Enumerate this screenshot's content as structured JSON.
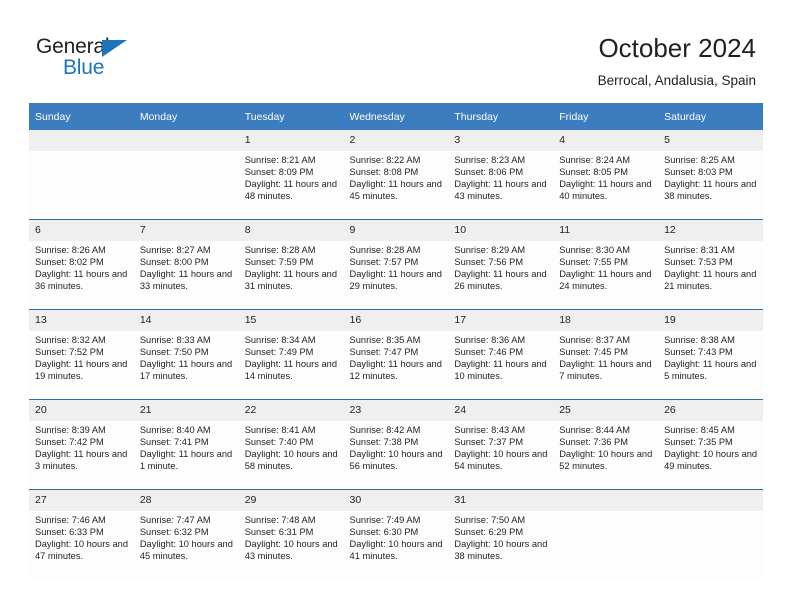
{
  "brand": {
    "name_top": "General",
    "name_bottom": "Blue",
    "triangle_color": "#1b75bb"
  },
  "header": {
    "title": "October 2024",
    "subtitle": "Berrocal, Andalusia, Spain"
  },
  "theme": {
    "header_row_bg": "#3b7dbf",
    "header_row_text": "#ffffff",
    "row_divider": "#2e6da8",
    "date_band_bg": "#efefef",
    "cell_bg": "#fdfdfd",
    "text": "#231f20"
  },
  "weekday_headers": [
    "Sunday",
    "Monday",
    "Tuesday",
    "Wednesday",
    "Thursday",
    "Friday",
    "Saturday"
  ],
  "labels": {
    "sunrise_prefix": "Sunrise:",
    "sunset_prefix": "Sunset:",
    "daylight_prefix": "Daylight:"
  },
  "weeks": [
    [
      {
        "day": "",
        "sunrise": "",
        "sunset": "",
        "daylight": ""
      },
      {
        "day": "",
        "sunrise": "",
        "sunset": "",
        "daylight": ""
      },
      {
        "day": "1",
        "sunrise": "Sunrise: 8:21 AM",
        "sunset": "Sunset: 8:09 PM",
        "daylight": "Daylight: 11 hours and 48 minutes."
      },
      {
        "day": "2",
        "sunrise": "Sunrise: 8:22 AM",
        "sunset": "Sunset: 8:08 PM",
        "daylight": "Daylight: 11 hours and 45 minutes."
      },
      {
        "day": "3",
        "sunrise": "Sunrise: 8:23 AM",
        "sunset": "Sunset: 8:06 PM",
        "daylight": "Daylight: 11 hours and 43 minutes."
      },
      {
        "day": "4",
        "sunrise": "Sunrise: 8:24 AM",
        "sunset": "Sunset: 8:05 PM",
        "daylight": "Daylight: 11 hours and 40 minutes."
      },
      {
        "day": "5",
        "sunrise": "Sunrise: 8:25 AM",
        "sunset": "Sunset: 8:03 PM",
        "daylight": "Daylight: 11 hours and 38 minutes."
      }
    ],
    [
      {
        "day": "6",
        "sunrise": "Sunrise: 8:26 AM",
        "sunset": "Sunset: 8:02 PM",
        "daylight": "Daylight: 11 hours and 36 minutes."
      },
      {
        "day": "7",
        "sunrise": "Sunrise: 8:27 AM",
        "sunset": "Sunset: 8:00 PM",
        "daylight": "Daylight: 11 hours and 33 minutes."
      },
      {
        "day": "8",
        "sunrise": "Sunrise: 8:28 AM",
        "sunset": "Sunset: 7:59 PM",
        "daylight": "Daylight: 11 hours and 31 minutes."
      },
      {
        "day": "9",
        "sunrise": "Sunrise: 8:28 AM",
        "sunset": "Sunset: 7:57 PM",
        "daylight": "Daylight: 11 hours and 29 minutes."
      },
      {
        "day": "10",
        "sunrise": "Sunrise: 8:29 AM",
        "sunset": "Sunset: 7:56 PM",
        "daylight": "Daylight: 11 hours and 26 minutes."
      },
      {
        "day": "11",
        "sunrise": "Sunrise: 8:30 AM",
        "sunset": "Sunset: 7:55 PM",
        "daylight": "Daylight: 11 hours and 24 minutes."
      },
      {
        "day": "12",
        "sunrise": "Sunrise: 8:31 AM",
        "sunset": "Sunset: 7:53 PM",
        "daylight": "Daylight: 11 hours and 21 minutes."
      }
    ],
    [
      {
        "day": "13",
        "sunrise": "Sunrise: 8:32 AM",
        "sunset": "Sunset: 7:52 PM",
        "daylight": "Daylight: 11 hours and 19 minutes."
      },
      {
        "day": "14",
        "sunrise": "Sunrise: 8:33 AM",
        "sunset": "Sunset: 7:50 PM",
        "daylight": "Daylight: 11 hours and 17 minutes."
      },
      {
        "day": "15",
        "sunrise": "Sunrise: 8:34 AM",
        "sunset": "Sunset: 7:49 PM",
        "daylight": "Daylight: 11 hours and 14 minutes."
      },
      {
        "day": "16",
        "sunrise": "Sunrise: 8:35 AM",
        "sunset": "Sunset: 7:47 PM",
        "daylight": "Daylight: 11 hours and 12 minutes."
      },
      {
        "day": "17",
        "sunrise": "Sunrise: 8:36 AM",
        "sunset": "Sunset: 7:46 PM",
        "daylight": "Daylight: 11 hours and 10 minutes."
      },
      {
        "day": "18",
        "sunrise": "Sunrise: 8:37 AM",
        "sunset": "Sunset: 7:45 PM",
        "daylight": "Daylight: 11 hours and 7 minutes."
      },
      {
        "day": "19",
        "sunrise": "Sunrise: 8:38 AM",
        "sunset": "Sunset: 7:43 PM",
        "daylight": "Daylight: 11 hours and 5 minutes."
      }
    ],
    [
      {
        "day": "20",
        "sunrise": "Sunrise: 8:39 AM",
        "sunset": "Sunset: 7:42 PM",
        "daylight": "Daylight: 11 hours and 3 minutes."
      },
      {
        "day": "21",
        "sunrise": "Sunrise: 8:40 AM",
        "sunset": "Sunset: 7:41 PM",
        "daylight": "Daylight: 11 hours and 1 minute."
      },
      {
        "day": "22",
        "sunrise": "Sunrise: 8:41 AM",
        "sunset": "Sunset: 7:40 PM",
        "daylight": "Daylight: 10 hours and 58 minutes."
      },
      {
        "day": "23",
        "sunrise": "Sunrise: 8:42 AM",
        "sunset": "Sunset: 7:38 PM",
        "daylight": "Daylight: 10 hours and 56 minutes."
      },
      {
        "day": "24",
        "sunrise": "Sunrise: 8:43 AM",
        "sunset": "Sunset: 7:37 PM",
        "daylight": "Daylight: 10 hours and 54 minutes."
      },
      {
        "day": "25",
        "sunrise": "Sunrise: 8:44 AM",
        "sunset": "Sunset: 7:36 PM",
        "daylight": "Daylight: 10 hours and 52 minutes."
      },
      {
        "day": "26",
        "sunrise": "Sunrise: 8:45 AM",
        "sunset": "Sunset: 7:35 PM",
        "daylight": "Daylight: 10 hours and 49 minutes."
      }
    ],
    [
      {
        "day": "27",
        "sunrise": "Sunrise: 7:46 AM",
        "sunset": "Sunset: 6:33 PM",
        "daylight": "Daylight: 10 hours and 47 minutes."
      },
      {
        "day": "28",
        "sunrise": "Sunrise: 7:47 AM",
        "sunset": "Sunset: 6:32 PM",
        "daylight": "Daylight: 10 hours and 45 minutes."
      },
      {
        "day": "29",
        "sunrise": "Sunrise: 7:48 AM",
        "sunset": "Sunset: 6:31 PM",
        "daylight": "Daylight: 10 hours and 43 minutes."
      },
      {
        "day": "30",
        "sunrise": "Sunrise: 7:49 AM",
        "sunset": "Sunset: 6:30 PM",
        "daylight": "Daylight: 10 hours and 41 minutes."
      },
      {
        "day": "31",
        "sunrise": "Sunrise: 7:50 AM",
        "sunset": "Sunset: 6:29 PM",
        "daylight": "Daylight: 10 hours and 38 minutes."
      },
      {
        "day": "",
        "sunrise": "",
        "sunset": "",
        "daylight": ""
      },
      {
        "day": "",
        "sunrise": "",
        "sunset": "",
        "daylight": ""
      }
    ]
  ]
}
